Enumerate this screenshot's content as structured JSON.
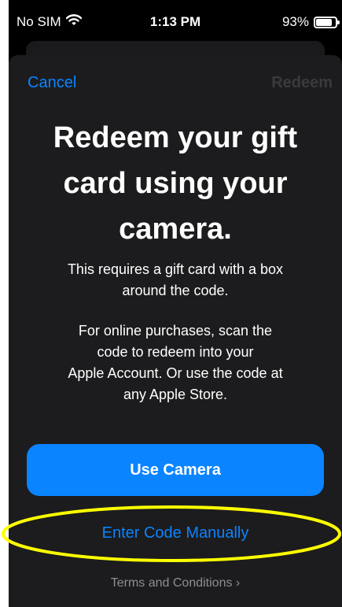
{
  "status_bar": {
    "carrier": "No SIM",
    "time": "1:13 PM",
    "battery": "93%",
    "battery_level": 0.93,
    "wifi_icon": "wifi-icon",
    "battery_icon": "battery-icon"
  },
  "nav": {
    "cancel_label": "Cancel",
    "redeem_label": "Redeem"
  },
  "content": {
    "title_lines": [
      "Redeem your gift",
      "card using your",
      "camera."
    ],
    "paragraph_1": [
      "This requires a gift card with a box",
      "around the code."
    ],
    "paragraph_2": [
      "For online purchases, scan the",
      "code to redeem into your",
      "Apple Account. Or use the code at",
      "any Apple Store."
    ]
  },
  "actions": {
    "use_camera_label": "Use Camera",
    "enter_code_label": "Enter Code Manually",
    "terms_label": "Terms and Conditions ›"
  },
  "colors": {
    "accent": "#0a84ff",
    "sheet_background": "#1c1c1e",
    "disabled_text": "#3a3a3c",
    "secondary_text": "#8e8e93",
    "highlight": "#ffff00"
  }
}
